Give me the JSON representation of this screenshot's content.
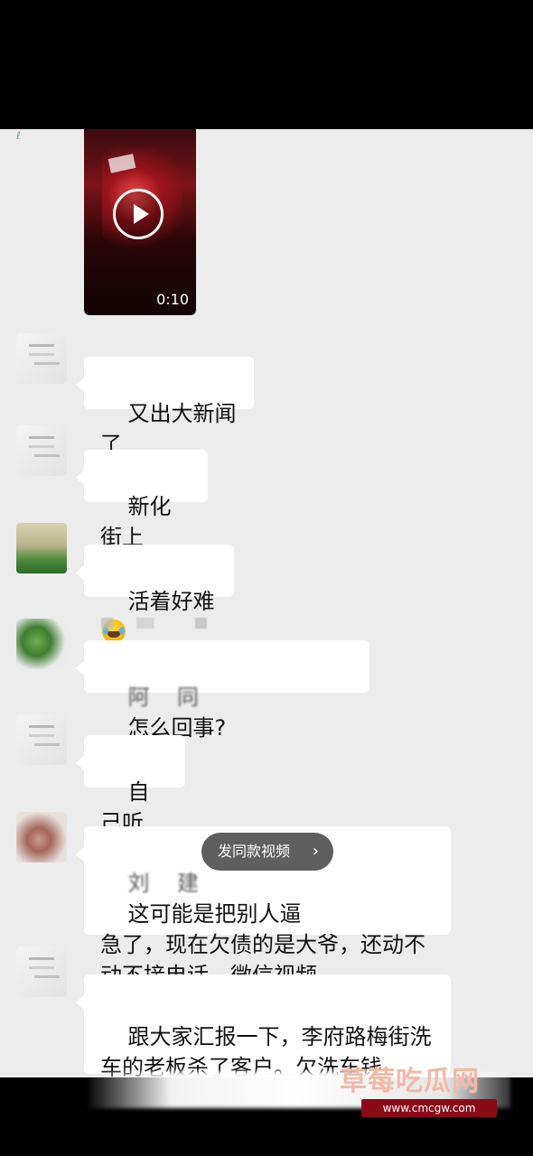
{
  "video": {
    "duration": "0:10",
    "play_icon": "play-icon"
  },
  "messages": [
    {
      "text": "又出大新闻了"
    },
    {
      "text": "新化街上"
    },
    {
      "text": "活着好难",
      "emoji": "crying-laughing-emoji"
    },
    {
      "masked_prefix": "阿    同",
      "text": "怎么回事?"
    },
    {
      "text": "自己听"
    },
    {
      "masked_prefix": "刘    建",
      "text": "这可能是把别人逼\n急了，现在欠债的是大爷，还动不\n动不接电话，微信视频"
    },
    {
      "text": "跟大家汇报一下，李府路梅街洗\n车的老板杀了客户。欠洗车钱"
    }
  ],
  "action_pill": {
    "label": "发同款视频",
    "chevron": "›"
  },
  "watermark": {
    "brand": "草莓吃瓜网",
    "url": "www.cmcgw.com"
  }
}
